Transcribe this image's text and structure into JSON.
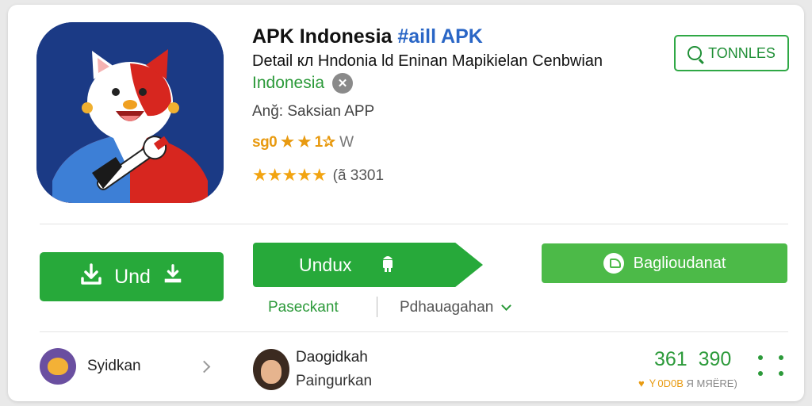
{
  "colors": {
    "primary_green": "#27a93a",
    "share_green": "#4cba48",
    "text_green": "#2c9a3a",
    "accent_blue": "#2a66c6",
    "star_orange": "#f2a411",
    "icon_background": "#1b3a85"
  },
  "app": {
    "icon": "mascot-app-icon",
    "title": "APK Indonesia",
    "title_accent": "#aill APK",
    "subtitle": "Detail кл Hndonia ld Eninan Mapikielan Cenbwian",
    "region": "Indonesia",
    "region_clear_icon": "close-icon",
    "author": "Anğ: Saksian APP",
    "rating_text": "sg0 ★ ★ 1✰",
    "rating_suffix": "W",
    "stars": "★★★★★",
    "rating_count": "(ã 3301"
  },
  "follow_button": {
    "label": "TONNLES",
    "icon": "search-refresh-icon"
  },
  "actions": {
    "download": {
      "label": "Und",
      "icon": "download-icon"
    },
    "install": {
      "label": "Undux",
      "icon": "android-icon"
    },
    "share": {
      "label": "Baglioudanat",
      "icon": "share-bubble-icon"
    },
    "link_left": "Paseckant",
    "dropdown": {
      "label": "Pdhauagahan",
      "icon": "chevron-down-icon"
    }
  },
  "footer": {
    "user_left": {
      "name": "Syidkan",
      "icon": "avatar"
    },
    "user_mid": {
      "name": "Daogidkah",
      "sub": "Paingurkan",
      "icon": "avatar"
    },
    "stats": {
      "value": "361  390",
      "sub_heart": "♥",
      "sub_text": "Ｙ0D0B",
      "sub_muted": "Я МЯЁRЕ)"
    },
    "more_icon": "more-dots-icon"
  }
}
